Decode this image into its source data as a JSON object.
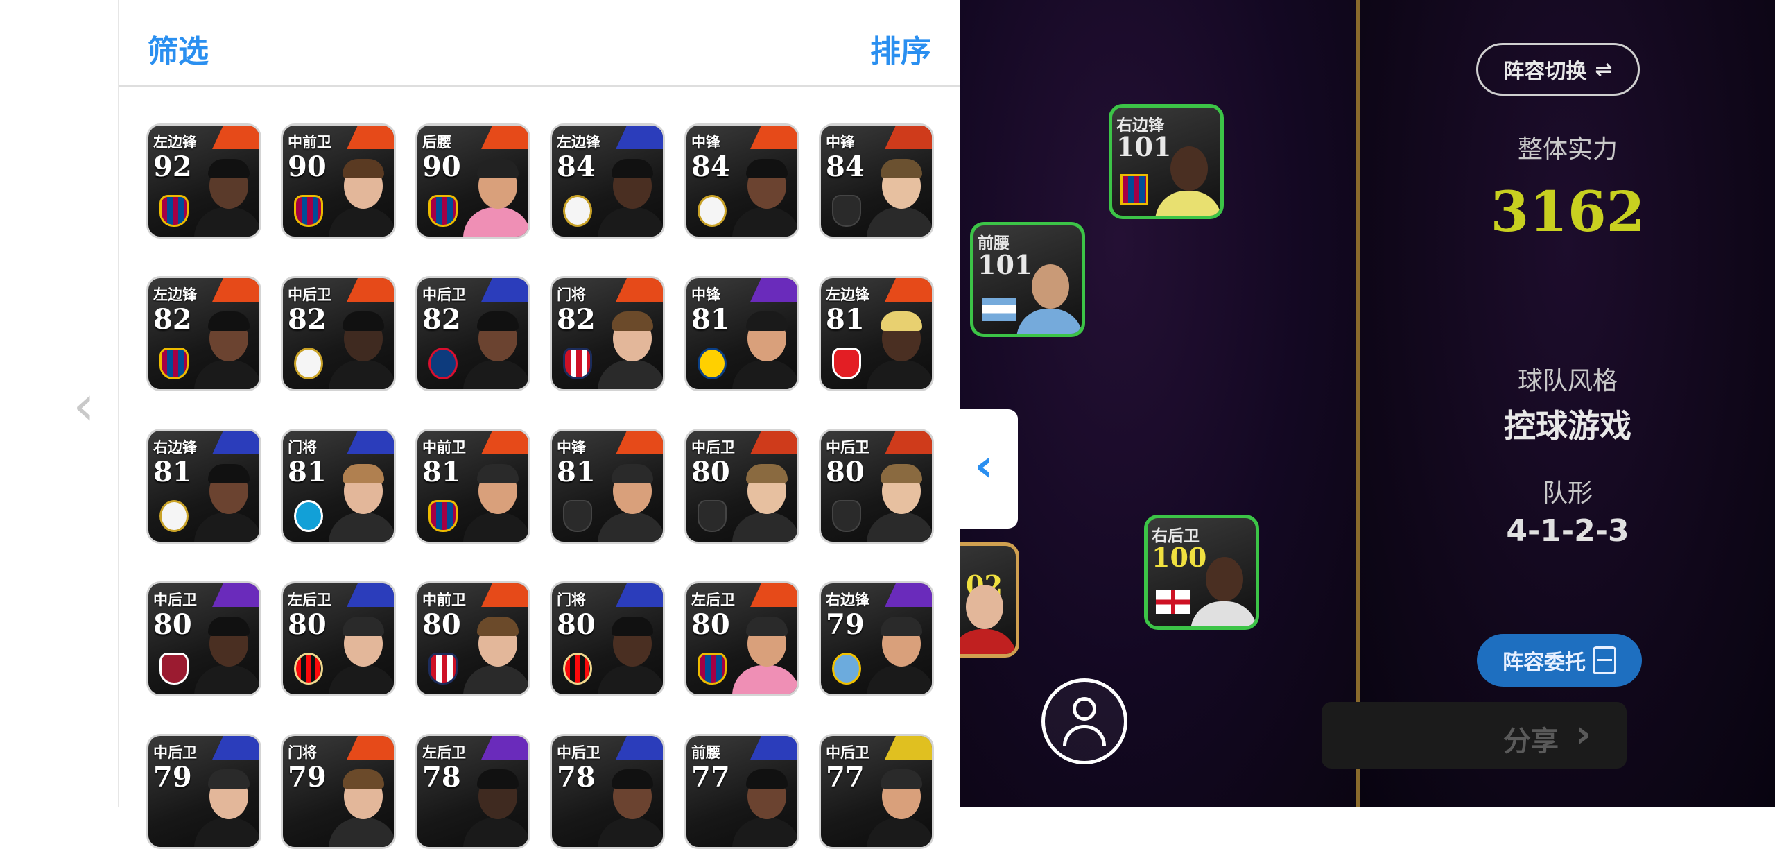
{
  "panel": {
    "filter_label": "筛选",
    "sort_label": "排序"
  },
  "player_cards": [
    {
      "position": "左边锋",
      "rating": "92",
      "badge": "badge-shield",
      "stripe": "#e64a19",
      "skin": "#5a3a2a",
      "hair": "#111111",
      "shirt": "#1a1a1a"
    },
    {
      "position": "中前卫",
      "rating": "90",
      "badge": "badge-shield",
      "stripe": "#e64a19",
      "skin": "#e3b79a",
      "hair": "#5a3a22",
      "shirt": "#1a1a1a"
    },
    {
      "position": "后腰",
      "rating": "90",
      "badge": "badge-shield",
      "stripe": "#e64a19",
      "skin": "#d9a07b",
      "hair": "#222222",
      "shirt": "#ef8fb5"
    },
    {
      "position": "左边锋",
      "rating": "84",
      "badge": "badge-rm",
      "stripe": "#2b3dbb",
      "skin": "#4a2f22",
      "hair": "#111111",
      "shirt": "#1a1a1a"
    },
    {
      "position": "中锋",
      "rating": "84",
      "badge": "badge-rm",
      "stripe": "#e64a19",
      "skin": "#6b4330",
      "hair": "#111111",
      "shirt": "#1a1a1a"
    },
    {
      "position": "中锋",
      "rating": "84",
      "badge": "badge-blank",
      "stripe": "#cf3b1b",
      "skin": "#e7c0a0",
      "hair": "#6b5130",
      "shirt": "#2a2a2a"
    },
    {
      "position": "左边锋",
      "rating": "82",
      "badge": "badge-shield",
      "stripe": "#e64a19",
      "skin": "#6b4330",
      "hair": "#111111",
      "shirt": "#1a1a1a"
    },
    {
      "position": "中后卫",
      "rating": "82",
      "badge": "badge-rm",
      "stripe": "#e64a19",
      "skin": "#3f2a20",
      "hair": "#111111",
      "shirt": "#1a1a1a"
    },
    {
      "position": "中后卫",
      "rating": "82",
      "badge": "badge-psg",
      "stripe": "#2b3dbb",
      "skin": "#6b4330",
      "hair": "#111111",
      "shirt": "#1a1a1a"
    },
    {
      "position": "门将",
      "rating": "82",
      "badge": "badge-atm",
      "stripe": "#e64a19",
      "skin": "#e3b79a",
      "hair": "#6b4a2a",
      "shirt": "#2a2a2a"
    },
    {
      "position": "中锋",
      "rating": "81",
      "badge": "badge-nassr",
      "stripe": "#6a2bbb",
      "skin": "#d9a07b",
      "hair": "#1a1a1a",
      "shirt": "#1a1a1a"
    },
    {
      "position": "左边锋",
      "rating": "81",
      "badge": "badge-red",
      "stripe": "#e64a19",
      "skin": "#4a2f22",
      "hair": "#e8d070",
      "shirt": "#1a1a1a"
    },
    {
      "position": "右边锋",
      "rating": "81",
      "badge": "badge-rm",
      "stripe": "#2b3dbb",
      "skin": "#6b4330",
      "hair": "#111111",
      "shirt": "#1a1a1a"
    },
    {
      "position": "门将",
      "rating": "81",
      "badge": "badge-nap",
      "stripe": "#2b3dbb",
      "skin": "#e3b79a",
      "hair": "#b08050",
      "shirt": "#2a2a2a"
    },
    {
      "position": "中前卫",
      "rating": "81",
      "badge": "badge-shield",
      "stripe": "#e64a19",
      "skin": "#d9a07b",
      "hair": "#2a2a2a",
      "shirt": "#1a1a1a"
    },
    {
      "position": "中锋",
      "rating": "81",
      "badge": "badge-blank",
      "stripe": "#e64a19",
      "skin": "#d9a07b",
      "hair": "#2a2a2a",
      "shirt": "#2a2a2a"
    },
    {
      "position": "中后卫",
      "rating": "80",
      "badge": "badge-blank",
      "stripe": "#cf3b1b",
      "skin": "#e7c0a0",
      "hair": "#8a6a40",
      "shirt": "#2a2a2a"
    },
    {
      "position": "中后卫",
      "rating": "80",
      "badge": "badge-blank",
      "stripe": "#cf3b1b",
      "skin": "#e7c0a0",
      "hair": "#8a6a40",
      "shirt": "#2a2a2a"
    },
    {
      "position": "中后卫",
      "rating": "80",
      "badge": "badge-rose",
      "stripe": "#6a2bbb",
      "skin": "#4a2f22",
      "hair": "#111111",
      "shirt": "#1a1a1a"
    },
    {
      "position": "左后卫",
      "rating": "80",
      "badge": "badge-milan",
      "stripe": "#2b3dbb",
      "skin": "#e3b79a",
      "hair": "#2a2a2a",
      "shirt": "#1a1a1a"
    },
    {
      "position": "中前卫",
      "rating": "80",
      "badge": "badge-atm",
      "stripe": "#e64a19",
      "skin": "#e3b79a",
      "hair": "#6b4a2a",
      "shirt": "#2a2a2a"
    },
    {
      "position": "门将",
      "rating": "80",
      "badge": "badge-milan",
      "stripe": "#2b3dbb",
      "skin": "#4a2f22",
      "hair": "#111111",
      "shirt": "#1a1a1a"
    },
    {
      "position": "左后卫",
      "rating": "80",
      "badge": "badge-shield",
      "stripe": "#e64a19",
      "skin": "#d9a07b",
      "hair": "#2a2a2a",
      "shirt": "#ef8fb5"
    },
    {
      "position": "右边锋",
      "rating": "79",
      "badge": "badge-sky",
      "stripe": "#6a2bbb",
      "skin": "#d9a07b",
      "hair": "#2a2a2a",
      "shirt": "#1a1a1a"
    },
    {
      "position": "中后卫",
      "rating": "79",
      "badge": "badge-blank",
      "stripe": "#2b3dbb",
      "skin": "#e3b79a",
      "hair": "#2a2a2a",
      "shirt": "#1a1a1a"
    },
    {
      "position": "门将",
      "rating": "79",
      "badge": "badge-blank",
      "stripe": "#e64a19",
      "skin": "#e3b79a",
      "hair": "#6b4a2a",
      "shirt": "#2a2a2a"
    },
    {
      "position": "左后卫",
      "rating": "78",
      "badge": "badge-blank",
      "stripe": "#6a2bbb",
      "skin": "#3f2a20",
      "hair": "#111111",
      "shirt": "#1a1a1a"
    },
    {
      "position": "中后卫",
      "rating": "78",
      "badge": "badge-blank",
      "stripe": "#2b3dbb",
      "skin": "#6b4330",
      "hair": "#111111",
      "shirt": "#1a1a1a"
    },
    {
      "position": "前腰",
      "rating": "77",
      "badge": "badge-blank",
      "stripe": "#2b3dbb",
      "skin": "#6b4330",
      "hair": "#111111",
      "shirt": "#1a1a1a"
    },
    {
      "position": "中后卫",
      "rating": "77",
      "badge": "badge-blank",
      "stripe": "#e0c020",
      "skin": "#d9a07b",
      "hair": "#2a2a2a",
      "shirt": "#1a1a1a"
    }
  ],
  "pitch": {
    "cards": [
      {
        "position": "右边锋",
        "rating": "101",
        "style": "green",
        "rating_color": "white",
        "flag": "badge-shield",
        "skin": "#4a2f22",
        "shirt": "#e8e070"
      },
      {
        "position": "前腰",
        "rating": "101",
        "style": "green",
        "rating_color": "white",
        "flag": "flag-arg",
        "skin": "#c99a77",
        "shirt": "#75aadb"
      },
      {
        "position": "右后卫",
        "rating": "100",
        "style": "green",
        "rating_color": "yellow",
        "flag": "flag-eng",
        "skin": "#4a2f22",
        "shirt": "#e0e0e0"
      },
      {
        "position": "",
        "rating": "02",
        "style": "gold",
        "rating_color": "yellow",
        "flag": "",
        "skin": "#e3b79a",
        "shirt": "#c02020"
      }
    ]
  },
  "right_panel": {
    "swap_button": "阵容切换",
    "strength_label": "整体实力",
    "strength_value": "3162",
    "style_label": "球队风格",
    "style_value": "控球游戏",
    "formation_label": "队形",
    "formation_value": "4-1-2-3",
    "delegate_button": "阵容委托",
    "share_button": "分享"
  }
}
